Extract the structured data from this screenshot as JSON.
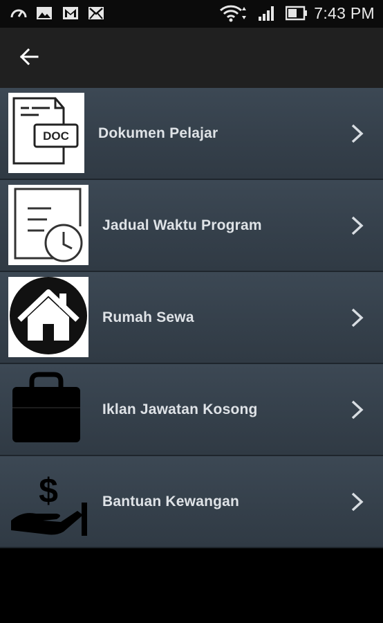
{
  "status_bar": {
    "time": "7:43 PM",
    "icons": [
      "speedometer-icon",
      "image-icon",
      "gmail-icon",
      "mail-icon",
      "wifi-icon",
      "signal-icon",
      "battery-icon"
    ]
  },
  "app_bar": {
    "back_icon": "arrow-left-icon"
  },
  "menu": {
    "items": [
      {
        "label": "Dokumen Pelajar",
        "icon": "doc-file-icon",
        "doc_text": "DOC"
      },
      {
        "label": "Jadual Waktu Program",
        "icon": "schedule-clock-icon"
      },
      {
        "label": "Rumah Sewa",
        "icon": "house-icon"
      },
      {
        "label": "Iklan Jawatan Kosong",
        "icon": "briefcase-icon"
      },
      {
        "label": "Bantuan Kewangan",
        "icon": "money-hand-icon",
        "symbol": "$"
      }
    ]
  },
  "colors": {
    "app_bar": "#202020",
    "list_item": "#36414c",
    "label_text": "#dfe3e7",
    "background": "#000000"
  }
}
